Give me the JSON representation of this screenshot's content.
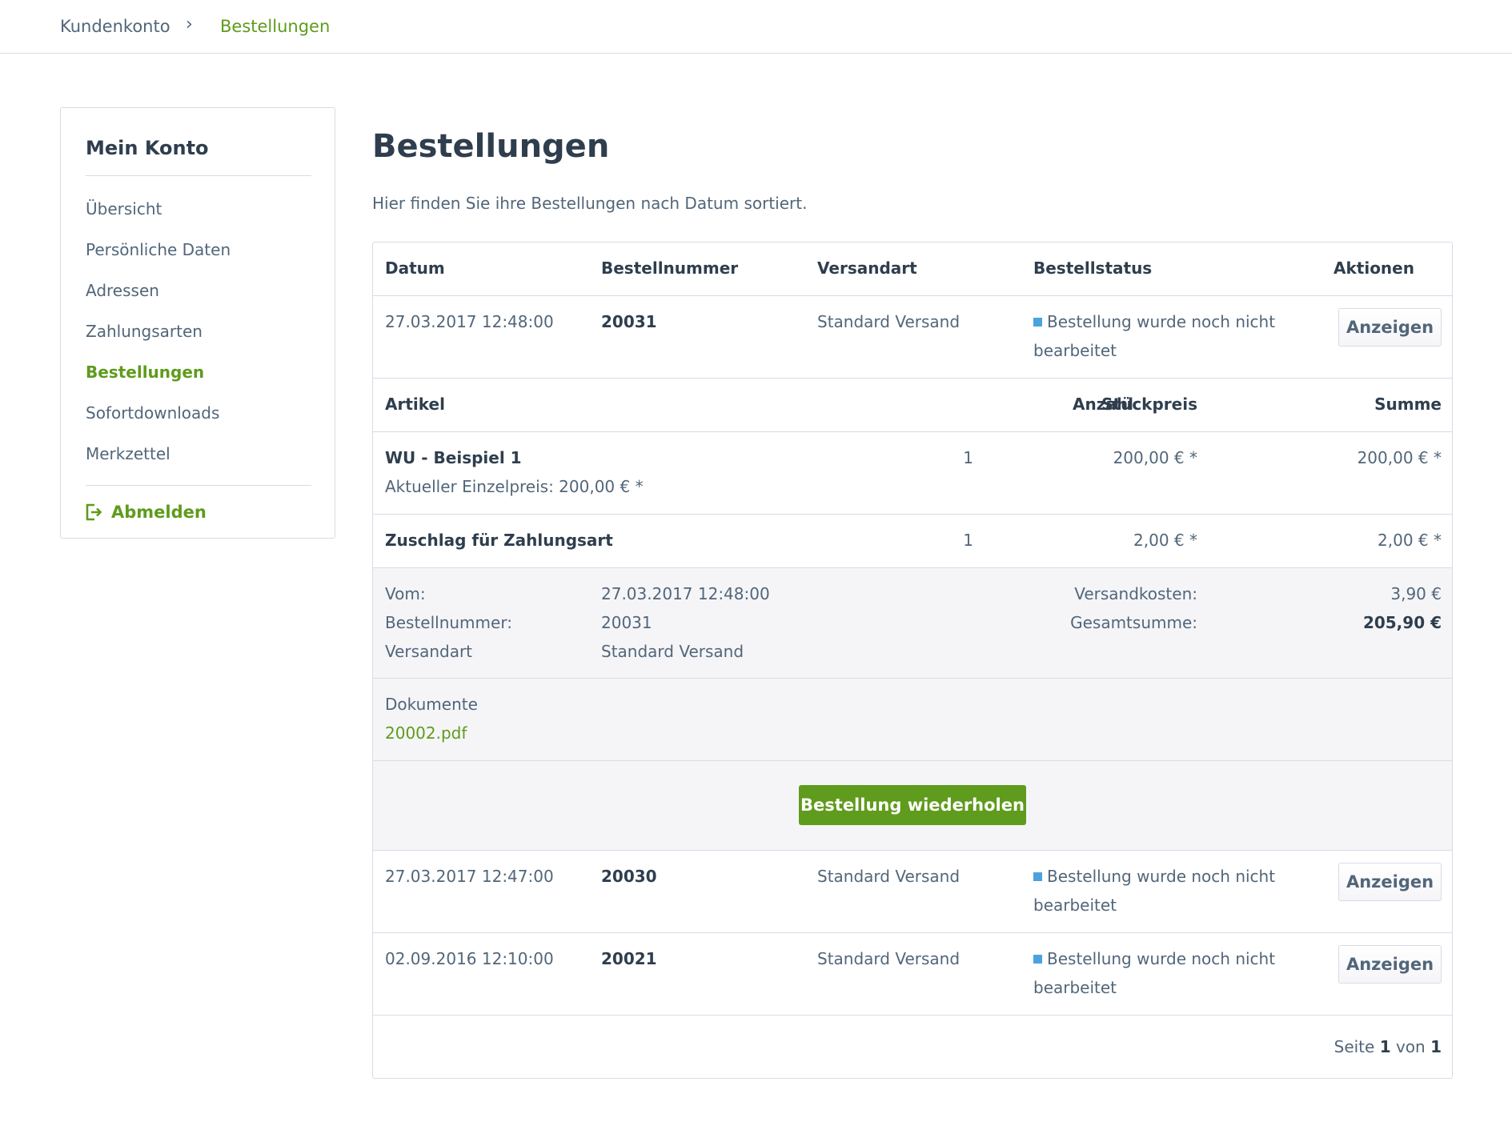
{
  "breadcrumb": {
    "home": "Kundenkonto",
    "separator": "›",
    "current": "Bestellungen"
  },
  "sidebar": {
    "title": "Mein Konto",
    "items": [
      "Übersicht",
      "Persönliche Daten",
      "Adressen",
      "Zahlungsarten",
      "Bestellungen",
      "Sofortdownloads",
      "Merkzettel"
    ],
    "active_index": 4,
    "logout": "Abmelden",
    "logout_icon": "logout-icon"
  },
  "main": {
    "title": "Bestellungen",
    "subtitle": "Hier finden Sie ihre Bestellungen nach Datum sortiert."
  },
  "table": {
    "headers": {
      "date": "Datum",
      "number": "Bestellnummer",
      "shipping": "Versandart",
      "status": "Bestellstatus",
      "actions": "Aktionen"
    },
    "orders": [
      {
        "date": "27.03.2017 12:48:00",
        "number": "20031",
        "shipping": "Standard Versand",
        "status_line1": "Bestellung wurde noch nicht",
        "status_line2": "bearbeitet",
        "button": "Anzeigen"
      },
      {
        "date": "27.03.2017 12:47:00",
        "number": "20030",
        "shipping": "Standard Versand",
        "status_line1": "Bestellung wurde noch nicht",
        "status_line2": "bearbeitet",
        "button": "Anzeigen"
      },
      {
        "date": "02.09.2016 12:10:00",
        "number": "20021",
        "shipping": "Standard Versand",
        "status_line1": "Bestellung wurde noch nicht",
        "status_line2": "bearbeitet",
        "button": "Anzeigen"
      }
    ],
    "status_color": "#4aa3df"
  },
  "detail": {
    "headers": {
      "article": "Artikel",
      "qty": "Anzahl",
      "unit_price": "Stückpreis",
      "sum": "Summe"
    },
    "items": [
      {
        "name": "WU - Beispiel 1",
        "note": "Aktueller Einzelpreis: 200,00 € *",
        "qty": "1",
        "unit_price": "200,00 € *",
        "sum": "200,00 € *"
      },
      {
        "name": "Zuschlag für Zahlungsart",
        "qty": "1",
        "unit_price": "2,00 € *",
        "sum": "2,00 € *"
      }
    ],
    "info": {
      "from_label": "Vom:",
      "from_value": "27.03.2017 12:48:00",
      "number_label": "Bestellnummer:",
      "number_value": "20031",
      "shipping_label": "Versandart",
      "shipping_value": "Standard Versand",
      "shipping_cost_label": "Versandkosten:",
      "shipping_cost_value": "3,90 €",
      "total_label": "Gesamtsumme:",
      "total_value": "205,90 €"
    },
    "documents_label": "Dokumente",
    "document_link": "20002.pdf",
    "repeat_button": "Bestellung wiederholen"
  },
  "pagination": {
    "prefix": "Seite",
    "current": "1",
    "middle": "von",
    "total": "1"
  },
  "colors": {
    "accent": "#5f9b1c",
    "text": "#52667a",
    "heading": "#2f3e4e",
    "border": "#dadae5",
    "muted_bg": "#f5f5f8"
  }
}
